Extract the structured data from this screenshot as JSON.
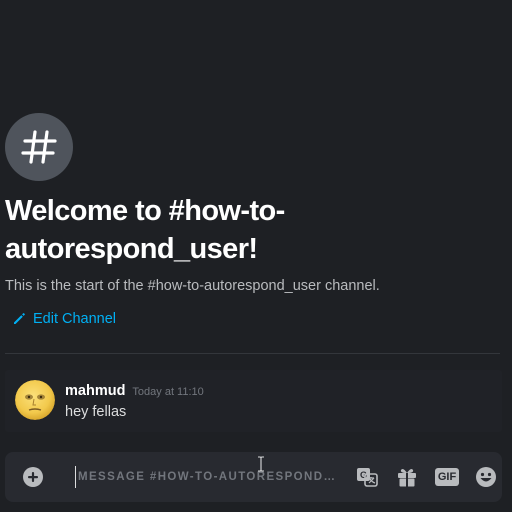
{
  "channel": {
    "icon": "hashtag-icon",
    "welcome_title": "Welcome to #how-to-autorespond_user!",
    "description": "This is the start of the #how-to-autorespond_user channel.",
    "edit_label": "Edit Channel"
  },
  "messages": [
    {
      "author": "mahmud",
      "timestamp": "Today at 11:10",
      "text": "hey fellas",
      "avatar": "yellow-face-avatar"
    }
  ],
  "composer": {
    "placeholder": "MESSAGE #HOW-TO-AUTORESPOND…",
    "add_icon": "plus-circle-icon",
    "tools": [
      {
        "name": "translate-icon"
      },
      {
        "name": "gift-icon"
      },
      {
        "name": "gif-button",
        "label": "GIF"
      },
      {
        "name": "emoji-icon"
      }
    ]
  },
  "colors": {
    "background": "#1e2024",
    "message_bg": "#202227",
    "composer_bg": "#282a30",
    "link": "#00b0f4",
    "heading": "#ffffff",
    "muted": "#b9bbbe"
  }
}
